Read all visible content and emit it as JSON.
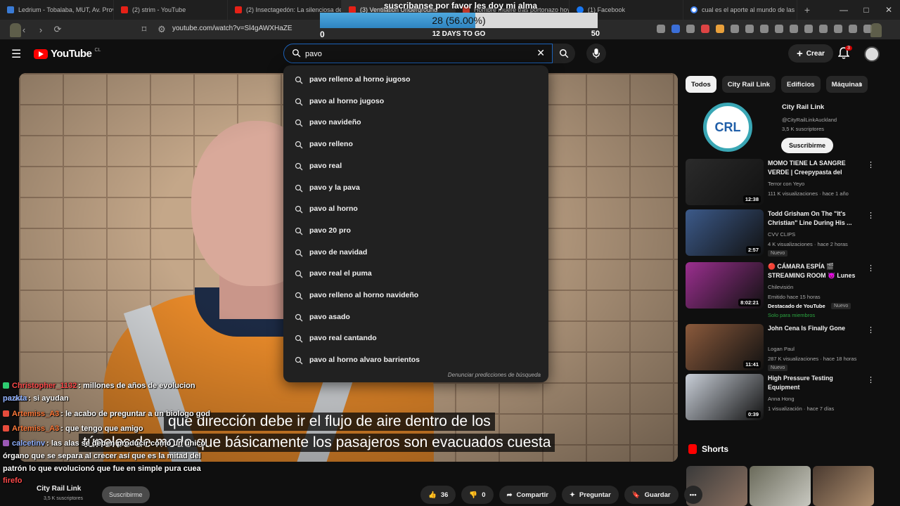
{
  "browser": {
    "tabs": [
      {
        "label": "Ledrium - Tobalaba, MUT, Av. Provid"
      },
      {
        "label": "(2) strim - YouTube"
      },
      {
        "label": "(2) Insectagedón: La silenciosa desa"
      },
      {
        "label": "(3) Ventilation Underground"
      },
      {
        "label": "Hombre muere tras portonazo hoy"
      },
      {
        "label": "(1) Facebook"
      },
      {
        "label": "cual es el aporte al mundo de las ar"
      }
    ],
    "new_tab": "+",
    "url": "youtube.com/watch?v=Sl4gAWXHaZE"
  },
  "overlay": {
    "title": "suscribanse por favor les doy mi alma",
    "goal_text": "28 (56.00%)",
    "goal_fraction": 0.56,
    "goal_min": "0",
    "goal_max": "50",
    "days_left": "12 DAYS TO GO"
  },
  "youtube": {
    "logo_text": "YouTube",
    "country": "CL",
    "search_value": "pavo",
    "create_label": "Crear",
    "notif_count": "3",
    "suggestions": [
      "pavo relleno al horno jugoso",
      "pavo al horno jugoso",
      "pavo navideño",
      "pavo relleno",
      "pavo real",
      "pavo y la pava",
      "pavo al horno",
      "pavo 20 pro",
      "pavo de navidad",
      "pavo real el puma",
      "pavo relleno al horno navideño",
      "pavo asado",
      "pavo real cantando",
      "pavo al horno alvaro barrientos"
    ],
    "report_label": "Denunciar predicciones de búsqueda"
  },
  "chips": [
    "Todos",
    "City Rail Link",
    "Edificios",
    "Máquinas"
  ],
  "channel_card": {
    "logo": "CRL",
    "name": "City Rail Link",
    "handle": "@CityRailLinkAuckland",
    "subs": "3,5 K suscriptores",
    "subscribe": "Suscribirme"
  },
  "recommendations": [
    {
      "title": "MOMO TIENE LA SANGRE VERDE | Creepypasta del chav...",
      "channel": "Terror con Yeyo",
      "meta": "111 K visualizaciones · hace 1 año",
      "duration": "12:38",
      "badge": "",
      "thumb_color": "#2b2b2b"
    },
    {
      "title": "Todd Grisham On The \"It's Christian\" Line During His ...",
      "channel": "CVV CLIPS",
      "meta": "4 K visualizaciones · hace 2 horas",
      "duration": "2:57",
      "badge": "Nuevo",
      "thumb_color": "#3c5a8a"
    },
    {
      "title": "🔴 CÁMARA ESPÍA 🎬 STREAMING ROOM 😈 Lunes ...",
      "channel": "Chilevisión",
      "meta": "Emitido hace 15 horas",
      "extra": "Destacado de YouTube",
      "badge": "Nuevo",
      "members": "Solo para miembros",
      "duration": "8:02:21",
      "thumb_color": "#9b2f8f"
    },
    {
      "title": "John Cena Is Finally Gone",
      "channel": "Logan Paul",
      "meta": "287 K visualizaciones · hace 18 horas",
      "duration": "11:41",
      "badge": "Nuevo",
      "thumb_color": "#8b5a3c"
    },
    {
      "title": "High Pressure Testing Equipment",
      "channel": "Anna Hong",
      "meta": "1 visualización · hace 7 días",
      "duration": "0:39",
      "badge": "",
      "thumb_color": "#c9cfd8"
    }
  ],
  "shorts": {
    "title": "Shorts"
  },
  "subtitles": {
    "line1": "qué dirección debe ir el flujo de aire dentro de los",
    "line2": "túneles de modo que básicamente los pasajeros son evacuados cuesta"
  },
  "video_below": {
    "channel": "City Rail Link",
    "subs": "3,5 K suscriptores",
    "subscribe": "Suscribirme",
    "likes": "36",
    "dislikes": "0",
    "share": "Compartir",
    "ask": "Preguntar",
    "save": "Guardar"
  },
  "chat": [
    {
      "user": "Christopher_1132",
      "msg": ": millones de años de evolucion nomas",
      "color": "#ff4a4a"
    },
    {
      "user": "pazkta",
      "msg": ": si ayudan",
      "color": "#8fb0ff"
    },
    {
      "user": "Artemiss_A3",
      "msg": ": le acabo de preguntar a un biologo god",
      "color": "#ff7a3a"
    },
    {
      "user": "Artemiss_A3",
      "msg": ": que tengo que amigo",
      "color": "#ff7a3a"
    },
    {
      "user": "calcetinv",
      "msg": ": las alas se deben producir como un único órgano que se separa al crecer así que es la mitad del patrón lo que evolucionó que fue en simple pura cuea",
      "color": "#8fb0ff"
    },
    {
      "user": "firefo",
      "msg": "",
      "color": "#ff4a4a"
    }
  ],
  "colors": {
    "accent": "#1c62b9",
    "yt_red": "#ff0000",
    "goal_fill": "#4ea8de"
  }
}
